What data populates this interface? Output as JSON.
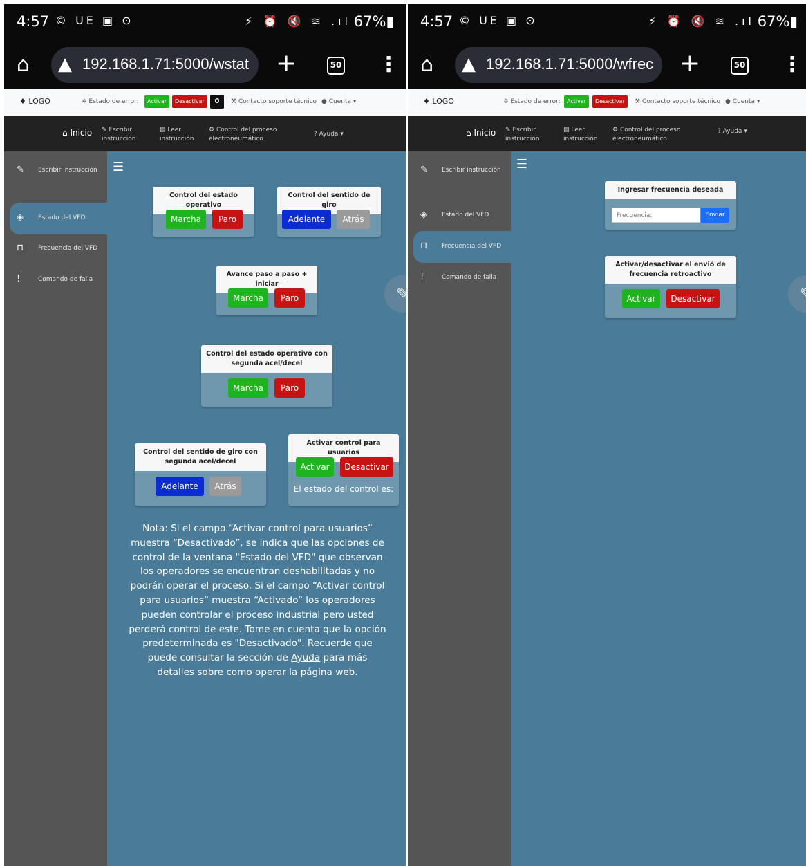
{
  "screens": [
    {
      "statusbar": {
        "time": "4:57",
        "left_icons": "© UE ▣ ⊙",
        "right_icons": "⚡ ⏰ 🔇 ≋ .ıl",
        "battery": "67%▮"
      },
      "browser": {
        "url": "192.168.1.71:5000/wstat",
        "tabs_count": "50"
      },
      "topnav": {
        "logo": "LOGO",
        "error_state_label": "Estado de error:",
        "error_activate": "Activar",
        "error_deactivate": "Desactivar",
        "error_count": "0",
        "support": "Contacto soporte técnico",
        "account": "Cuenta"
      },
      "mainnav": {
        "home": "Inicio",
        "write_1": "Escribir",
        "write_2": "instrucción",
        "read_1": "Leer",
        "read_2": "instrucción",
        "process_1": "Control del proceso",
        "process_2": "electroneumático",
        "help": "Ayuda"
      },
      "sidebar": [
        "Escribir instrucción",
        "Estado del VFD",
        "Frecuencia del VFD",
        "Comando de falla"
      ],
      "cards": {
        "op_state": {
          "title": "Control del estado operativo",
          "btn1": "Marcha",
          "btn2": "Paro"
        },
        "direction": {
          "title": "Control del sentido de giro",
          "btn1": "Adelante",
          "btn2": "Atrás"
        },
        "step": {
          "title": "Avance paso a paso + iniciar",
          "btn1": "Marcha",
          "btn2": "Paro"
        },
        "op_state2": {
          "title": "Control del estado operativo con segunda acel/decel",
          "btn1": "Marcha",
          "btn2": "Paro"
        },
        "direction2": {
          "title": "Control del sentido de giro con segunda acel/decel",
          "btn1": "Adelante",
          "btn2": "Atrás"
        },
        "user_ctrl": {
          "title": "Activar control para usuarios",
          "btn1": "Activar",
          "btn2": "Desactivar",
          "state": "El estado del control es:"
        }
      },
      "note": {
        "part1": "Nota: Si el campo “Activar control para usuarios” muestra “Desactivado”, se indica que las opciones de control de la ventana \"Estado del VFD\" que observan los operadores se encuentran deshabilitadas y no podrán operar el proceso. Si el campo “Activar control para usuarios” muestra “Activado” los operadores pueden controlar el proceso industrial pero usted perderá control de este. Tome en cuenta que la opción predeterminada es \"Desactivado\". Recuerde que puede consultar la sección de ",
        "link": "Ayuda",
        "part2": " para más detalles sobre como operar la página web."
      }
    },
    {
      "statusbar": {
        "time": "4:57",
        "left_icons": "© UE ▣ ⊙",
        "right_icons": "⚡ ⏰ 🔇 ≋ .ıl",
        "battery": "67%▮"
      },
      "browser": {
        "url": "192.168.1.71:5000/wfrec",
        "tabs_count": "50"
      },
      "topnav": {
        "logo": "LOGO",
        "error_state_label": "Estado de error:",
        "error_activate": "Activar",
        "error_deactivate": "Desactivar",
        "support": "Contacto soporte técnico",
        "account": "Cuenta"
      },
      "mainnav": {
        "home": "Inicio",
        "write_1": "Escribir",
        "write_2": "instrucción",
        "read_1": "Leer",
        "read_2": "instrucción",
        "process_1": "Control del proceso",
        "process_2": "electroneumático",
        "help": "Ayuda"
      },
      "sidebar": [
        "Escribir instrucción",
        "Estado del VFD",
        "Frecuencia del VFD",
        "Comando de falla"
      ],
      "cards": {
        "freq": {
          "title": "Ingresar frecuencia deseada",
          "placeholder": "Frecuencia:",
          "send": "Enviar"
        },
        "feedback": {
          "title": "Activar/desactivar el envió de frecuencia retroactivo",
          "btn1": "Activar",
          "btn2": "Desactivar"
        }
      }
    }
  ]
}
